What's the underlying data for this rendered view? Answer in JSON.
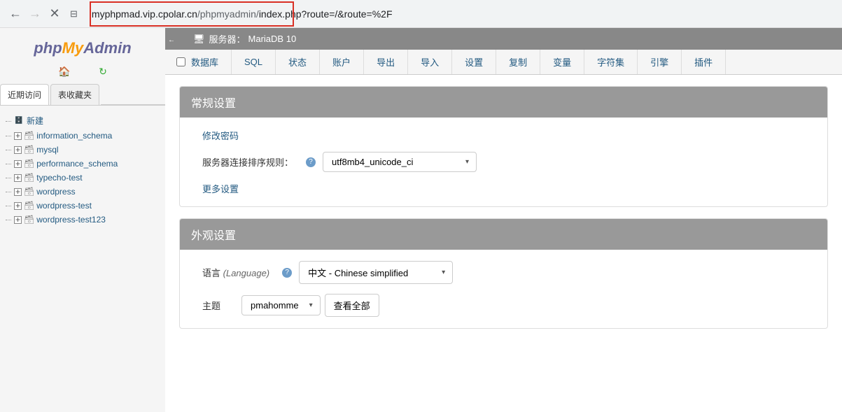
{
  "browser": {
    "url_host": "myphpmad.vip.cpolar.cn",
    "url_path": "/phpmyadmin/",
    "url_rest": "index.php?route=/&route=%2F"
  },
  "logo": {
    "php": "php",
    "my": "My",
    "admin": "Admin"
  },
  "sidebar_tabs": {
    "recent": "近期访问",
    "favorites": "表收藏夹"
  },
  "db_new": "新建",
  "databases": [
    "information_schema",
    "mysql",
    "performance_schema",
    "typecho-test",
    "wordpress",
    "wordpress-test",
    "wordpress-test123"
  ],
  "server": {
    "label": "服务器：",
    "name": "MariaDB 10"
  },
  "topnav": [
    "数据库",
    "SQL",
    "状态",
    "账户",
    "导出",
    "导入",
    "设置",
    "复制",
    "变量",
    "字符集",
    "引擎",
    "插件"
  ],
  "general": {
    "title": "常规设置",
    "change_password": "修改密码",
    "collation_label": "服务器连接排序规则：",
    "collation_value": "utf8mb4_unicode_ci",
    "more_settings": "更多设置"
  },
  "appearance": {
    "title": "外观设置",
    "language_label": "语言",
    "language_hint": "(Language)",
    "language_value": "中文 - Chinese simplified",
    "theme_label": "主题",
    "theme_value": "pmahomme",
    "view_all": "查看全部"
  }
}
